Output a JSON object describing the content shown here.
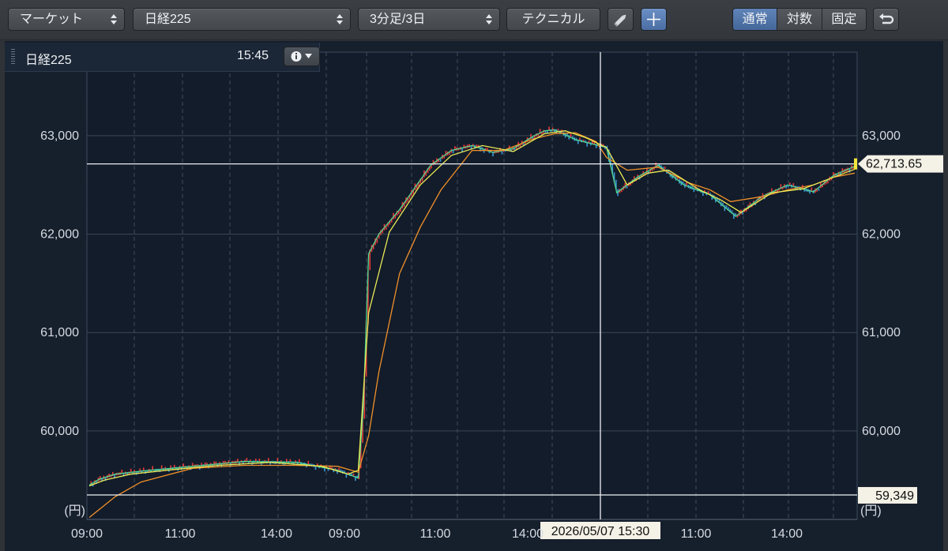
{
  "toolbar": {
    "market_label": "マーケット",
    "symbol_label": "日経225",
    "interval_label": "3分足/3日",
    "technical_label": "テクニカル",
    "scale_modes": [
      "通常",
      "対数",
      "固定"
    ],
    "active_scale_mode": "通常"
  },
  "info_box": {
    "name": "日経225",
    "time": "15:45"
  },
  "chart_data": {
    "type": "line",
    "title": "",
    "y_ticks": [
      "63,000",
      "62,000",
      "61,000",
      "60,000"
    ],
    "y_unit": "(円)",
    "ylim": [
      59100,
      63850
    ],
    "x_ticks": [
      "09:00",
      "11:00",
      "14:00",
      "09:00",
      "11:00",
      "14:00",
      "11:00",
      "14:00"
    ],
    "crosshair_time": "2026/05/07 15:30",
    "current_price": "62,713.65",
    "low_price": "59,349",
    "grid": true,
    "series": [
      {
        "color": "#50d890",
        "x": [
          0,
          2,
          5,
          10,
          20,
          30,
          40,
          48,
          52,
          53,
          54,
          56,
          60,
          66,
          70,
          74,
          78,
          82,
          86,
          88,
          90,
          94,
          100,
          102,
          106,
          110,
          115,
          120,
          125,
          130,
          135,
          140,
          144,
          148
        ],
        "values": [
          59450,
          59510,
          59560,
          59590,
          59640,
          59690,
          59680,
          59600,
          59520,
          60250,
          61800,
          62000,
          62250,
          62700,
          62850,
          62900,
          62830,
          62870,
          63000,
          63050,
          63060,
          62960,
          62880,
          62420,
          62580,
          62700,
          62500,
          62400,
          62180,
          62380,
          62500,
          62430,
          62600,
          62690
        ]
      },
      {
        "color": "#f0902a",
        "x": [
          0,
          5,
          10,
          20,
          30,
          40,
          48,
          52,
          54,
          56,
          60,
          64,
          68,
          74,
          80,
          86,
          90,
          94,
          98,
          100,
          104,
          110,
          116,
          120,
          124,
          130,
          135,
          140,
          144,
          148
        ],
        "values": [
          59120,
          59330,
          59480,
          59620,
          59650,
          59650,
          59640,
          59580,
          59950,
          60600,
          61600,
          62070,
          62450,
          62850,
          62850,
          62970,
          63020,
          63030,
          62940,
          62780,
          62650,
          62680,
          62520,
          62450,
          62330,
          62380,
          62450,
          62500,
          62580,
          62620
        ]
      },
      {
        "color": "#e9ea55",
        "x": [
          0,
          3,
          8,
          15,
          25,
          35,
          45,
          50,
          52,
          54,
          58,
          64,
          70,
          76,
          82,
          88,
          92,
          96,
          100,
          104,
          108,
          112,
          118,
          122,
          126,
          132,
          138,
          144,
          148
        ],
        "values": [
          59440,
          59500,
          59560,
          59600,
          59650,
          59680,
          59640,
          59560,
          59600,
          61200,
          62020,
          62500,
          62800,
          62900,
          62840,
          63020,
          63050,
          62980,
          62880,
          62500,
          62620,
          62650,
          62450,
          62350,
          62220,
          62420,
          62460,
          62580,
          62660
        ]
      }
    ]
  }
}
